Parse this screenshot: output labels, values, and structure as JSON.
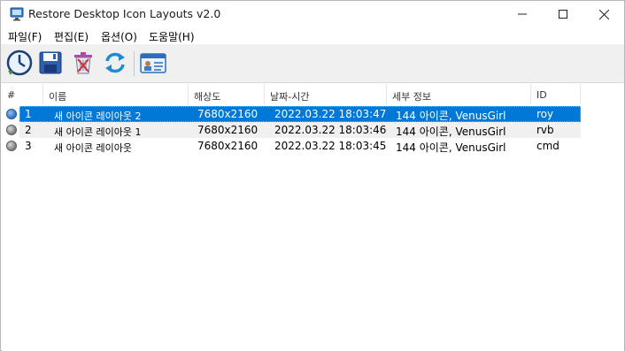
{
  "window": {
    "title": "Restore Desktop Icon Layouts v2.0",
    "app_icon": "monitor-icon"
  },
  "menu": [
    {
      "label": "파일(F)"
    },
    {
      "label": "편집(E)"
    },
    {
      "label": "옵션(O)"
    },
    {
      "label": "도움말(H)"
    }
  ],
  "toolbar": {
    "buttons": [
      "restore-clock-icon",
      "save-floppy-icon",
      "delete-trash-icon",
      "refresh-icon",
      "id-card-icon"
    ]
  },
  "table": {
    "columns": [
      "#",
      "이름",
      "해상도",
      "날짜-시간",
      "세부 정보",
      "ID"
    ],
    "rows": [
      {
        "num": "1",
        "name": "새 아이콘 레이아웃 2",
        "resolution": "7680x2160",
        "datetime": "2022.03.22 18:03:47",
        "details": "144 아이콘, VenusGirl",
        "id": "roy",
        "selected": true
      },
      {
        "num": "2",
        "name": "새 아이콘 레이아웃 1",
        "resolution": "7680x2160",
        "datetime": "2022.03.22 18:03:46",
        "details": "144 아이콘, VenusGirl",
        "id": "rvb",
        "selected": false
      },
      {
        "num": "3",
        "name": "새 아이콘 레이아웃",
        "resolution": "7680x2160",
        "datetime": "2022.03.22 18:03:45",
        "details": "144 아이콘, VenusGirl",
        "id": "cmd",
        "selected": false
      }
    ]
  },
  "colors": {
    "selection": "#0078d7",
    "toolbar_bg": "#f0f0f0"
  }
}
